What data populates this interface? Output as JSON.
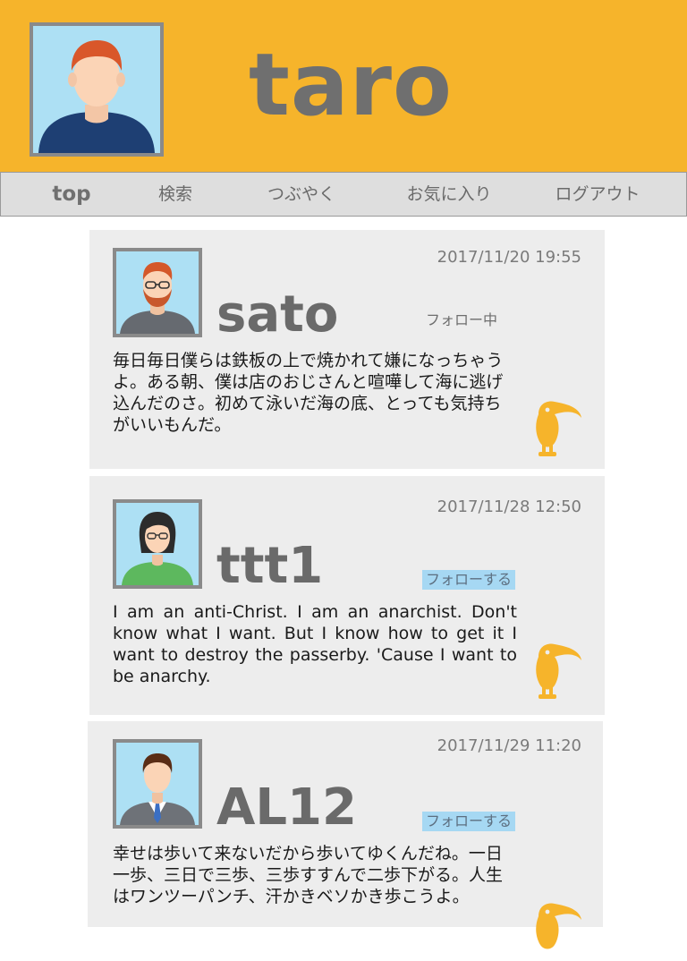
{
  "user": {
    "name": "taro"
  },
  "nav": {
    "top": "top",
    "search": "検索",
    "tweet": "つぶやく",
    "favorites": "お気に入り",
    "logout": "ログアウト"
  },
  "posts": [
    {
      "name": "sato",
      "date": "2017/11/20 19:55",
      "follow_label": "フォロー中",
      "text": "毎日毎日僕らは鉄板の上で焼かれて嫌になっちゃうよ。ある朝、僕は店のおじさんと喧嘩して海に逃げ込んだのさ。初めて泳いだ海の底、とっても気持ちがいいもんだ。"
    },
    {
      "name": "ttt1",
      "date": "2017/11/28 12:50",
      "follow_label": "フォローする",
      "text": "I am an anti-Christ. I am an anarchist. Don't know what I want. But I know how to get it I want to destroy the passerby. 'Cause I want to be anarchy."
    },
    {
      "name": "AL12",
      "date": "2017/11/29 11:20",
      "follow_label": "フォローする",
      "text": "幸せは歩いて来ないだから歩いてゆくんだね。一日一歩、三日で三歩、三歩すすんで二歩下がる。人生はワンツーパンチ、汗かきベソかき歩こうよ。"
    }
  ],
  "colors": {
    "header": "#f6b42b",
    "accent_follow": "#a6d8f3",
    "card": "#ededed"
  },
  "icons": {
    "post_action": "toucan-icon"
  }
}
